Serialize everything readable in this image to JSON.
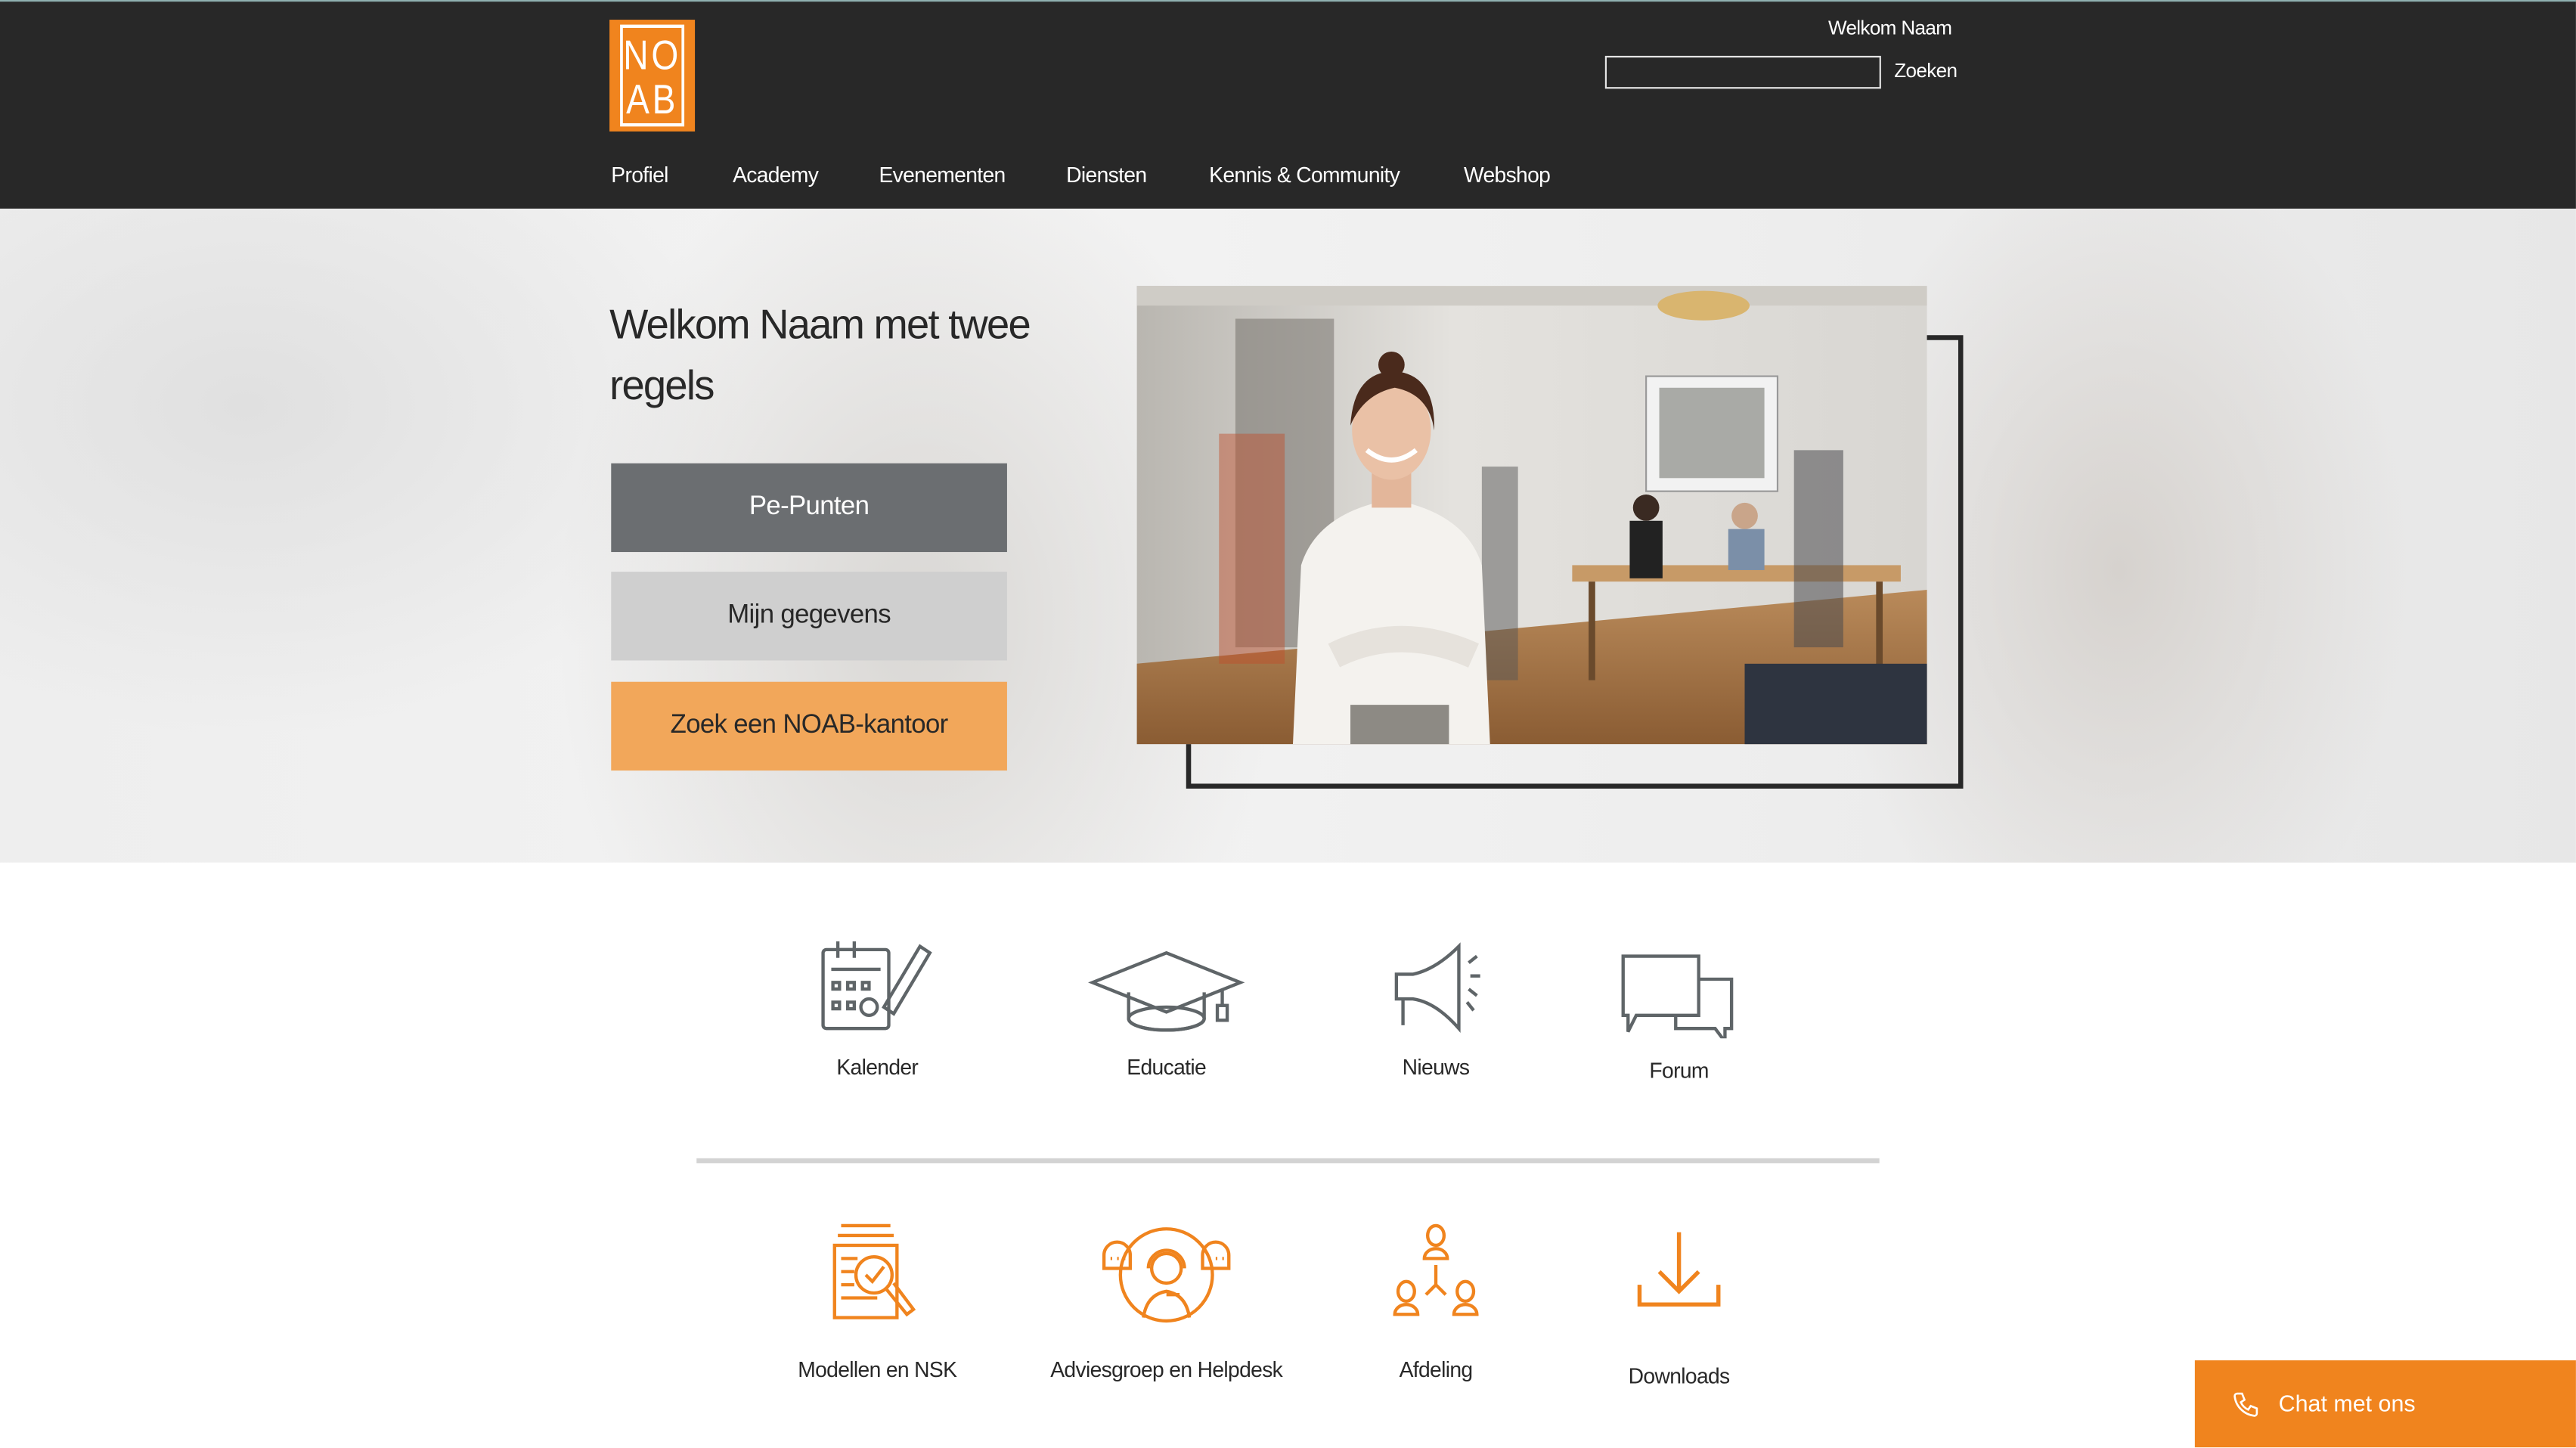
{
  "header": {
    "logo_text": [
      "NO",
      "AB"
    ],
    "welcome": "Welkom Naam",
    "search": {
      "value": "",
      "placeholder": ""
    },
    "search_button": "Zoeken",
    "nav": [
      "Profiel",
      "Academy",
      "Evenementen",
      "Diensten",
      "Kennis & Community",
      "Webshop"
    ]
  },
  "hero": {
    "title": "Welkom Naam met twee regels",
    "buttons": [
      {
        "label": "Pe-Punten",
        "color": "#6b6e71"
      },
      {
        "label": "Mijn gegevens",
        "color": "#cfcfcf"
      },
      {
        "label": "Zoek een NOAB-kantoor",
        "color": "#f2a75a"
      }
    ]
  },
  "tiles_row1": [
    {
      "label": "Kalender",
      "icon": "calendar-pencil-icon"
    },
    {
      "label": "Educatie",
      "icon": "graduation-cap-icon"
    },
    {
      "label": "Nieuws",
      "icon": "megaphone-icon"
    },
    {
      "label": "Forum",
      "icon": "chat-bubbles-icon"
    }
  ],
  "tiles_row2": [
    {
      "label": "Modellen en NSK",
      "icon": "document-search-icon"
    },
    {
      "label": "Adviesgroep en Helpdesk",
      "icon": "headset-support-icon"
    },
    {
      "label": "Afdeling",
      "icon": "people-network-icon"
    },
    {
      "label": "Downloads",
      "icon": "download-icon"
    }
  ],
  "chat": {
    "label": "Chat met ons",
    "icon": "phone-icon"
  },
  "colors": {
    "header": "#282828",
    "accent": "#f0841e",
    "icon_grey": "#5f6568"
  }
}
